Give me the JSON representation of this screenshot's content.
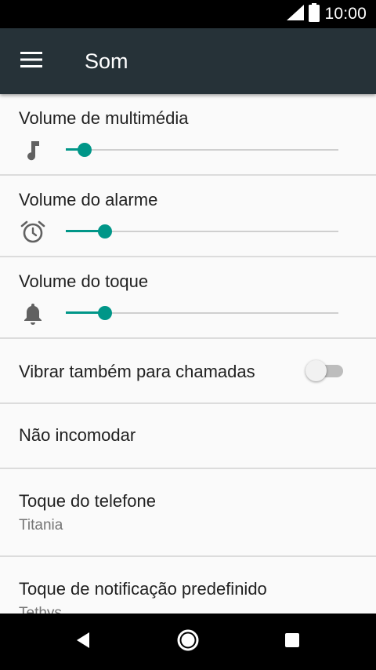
{
  "status_bar": {
    "time": "10:00"
  },
  "app_bar": {
    "title": "Som"
  },
  "volumes": [
    {
      "label": "Volume de multimédia",
      "icon": "music-note-icon",
      "level": 0.07
    },
    {
      "label": "Volume do alarme",
      "icon": "alarm-clock-icon",
      "level": 0.145
    },
    {
      "label": "Volume do toque",
      "icon": "bell-icon",
      "level": 0.145
    }
  ],
  "vibrate": {
    "label": "Vibrar também para chamadas",
    "enabled": false
  },
  "do_not_disturb": {
    "label": "Não incomodar"
  },
  "ringtone": {
    "label": "Toque do telefone",
    "value": "Titania"
  },
  "notification_sound": {
    "label": "Toque de notificação predefinido",
    "value": "Tethys"
  },
  "colors": {
    "accent": "#009688",
    "app_bar": "#263238",
    "background": "#fafafa"
  }
}
